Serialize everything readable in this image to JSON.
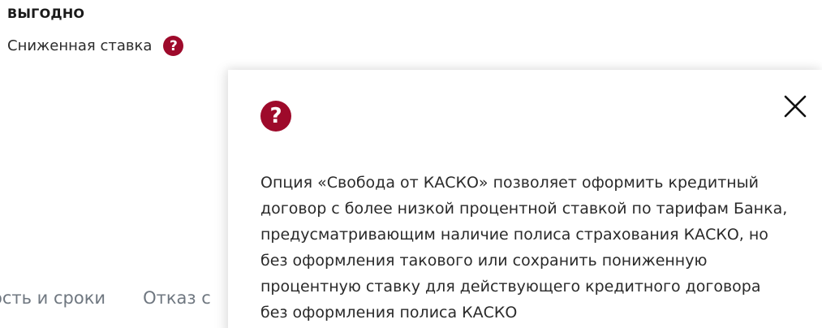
{
  "section": {
    "title": "ВЫГОДНО"
  },
  "rate": {
    "label": "Сниженная ставка",
    "help_glyph": "?"
  },
  "tabs": [
    {
      "label": "ость и сроки"
    },
    {
      "label": "Отказ с"
    }
  ],
  "popup": {
    "help_glyph": "?",
    "close_icon": "close-icon",
    "text_lines": [
      "Опция «Свобода от КАСКО» позволяет оформить кредитный",
      "договор с более низкой процентной ставкой по тарифам Банка,",
      "предусматривающим наличие полиса страхования КАСКО, но",
      "без оформления такового или сохранить пониженную",
      "процентную ставку для действующего кредитного договора",
      "без оформления полиса КАСКО"
    ]
  },
  "colors": {
    "accent": "#9e0a2b",
    "muted_text": "#6f7780"
  }
}
